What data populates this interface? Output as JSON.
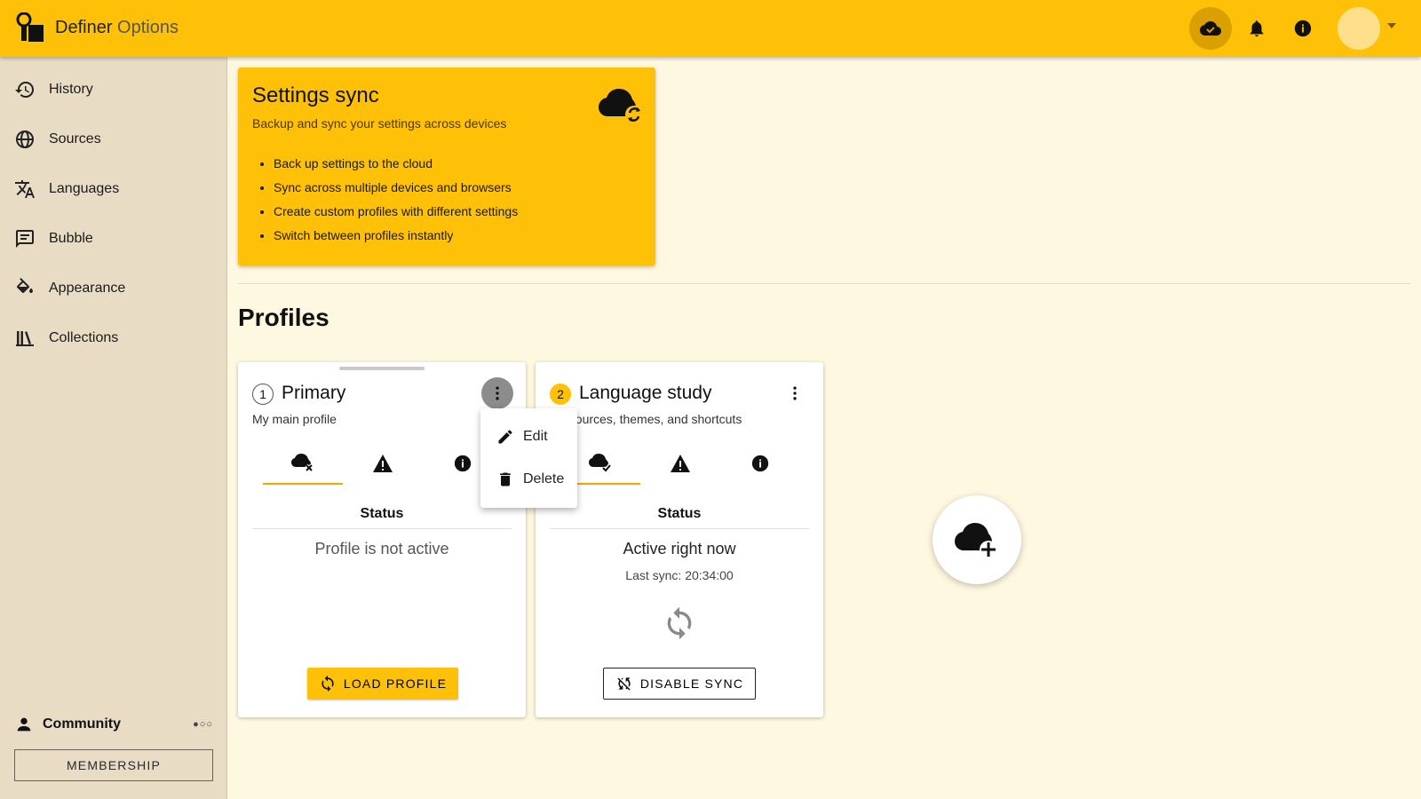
{
  "header": {
    "app_name": "Definer",
    "app_section": "Options"
  },
  "sidebar": {
    "items": [
      {
        "label": "History",
        "icon": "history-icon"
      },
      {
        "label": "Sources",
        "icon": "globe-icon"
      },
      {
        "label": "Languages",
        "icon": "translate-icon"
      },
      {
        "label": "Bubble",
        "icon": "message-icon"
      },
      {
        "label": "Appearance",
        "icon": "paint-bucket-icon"
      },
      {
        "label": "Collections",
        "icon": "library-icon"
      }
    ],
    "community_label": "Community",
    "community_dots": "●○○",
    "membership_label": "MEMBERSHIP"
  },
  "sync_card": {
    "title": "Settings sync",
    "subtitle": "Backup and sync your settings across devices",
    "features": [
      "Back up settings to the cloud",
      "Sync across multiple devices and browsers",
      "Create custom profiles with different settings",
      "Switch between profiles instantly"
    ]
  },
  "profiles": {
    "title": "Profiles",
    "cards": [
      {
        "number": "1",
        "name": "Primary",
        "description": "My main profile",
        "status_heading": "Status",
        "status_text": "Profile is not active",
        "button_label": "LOAD PROFILE"
      },
      {
        "number": "2",
        "name": "Language study",
        "description": "ish sources, themes, and shortcuts",
        "status_heading": "Status",
        "status_text": "Active right now",
        "last_sync": "Last sync: 20:34:00",
        "button_label": "DISABLE SYNC"
      }
    ]
  },
  "menu": {
    "edit_label": "Edit",
    "delete_label": "Delete"
  },
  "colors": {
    "accent": "#ffc107",
    "sidebar_bg": "#e8dcc5",
    "page_bg": "#fff8e1"
  }
}
